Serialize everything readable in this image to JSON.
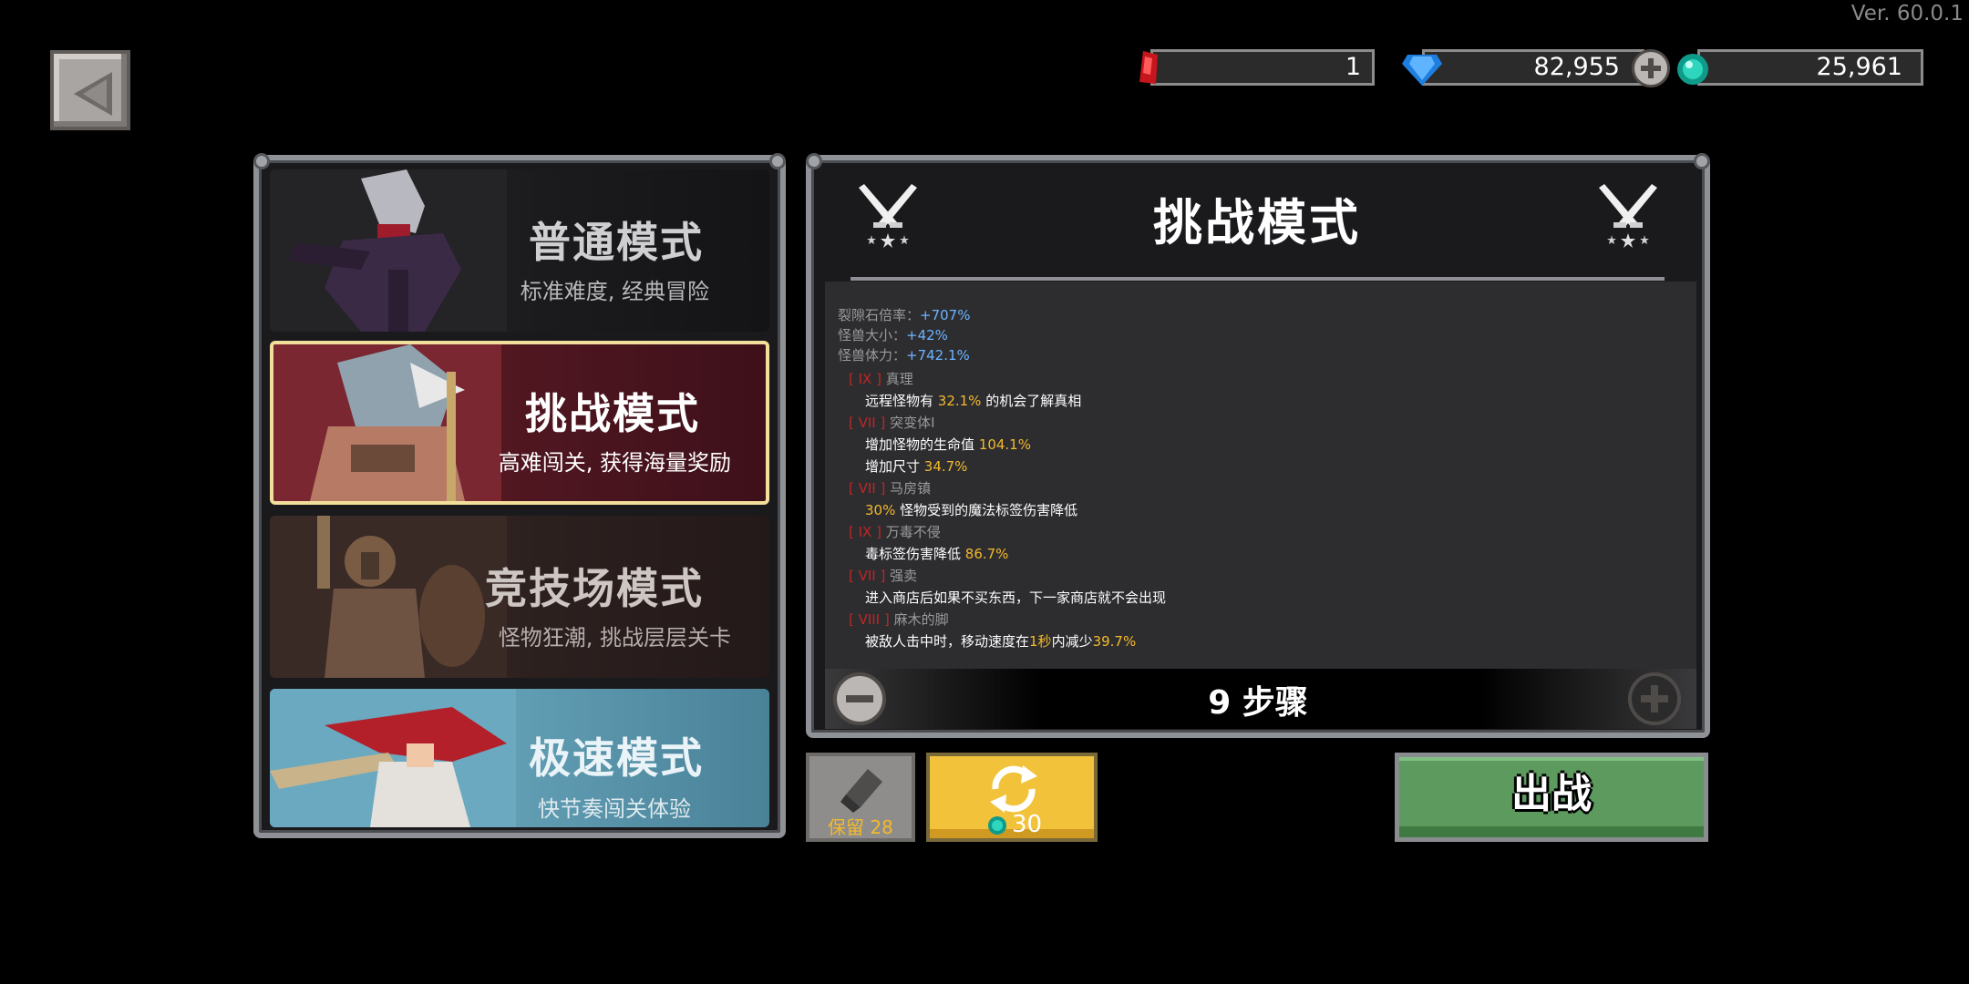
{
  "version": "Ver. 60.0.1",
  "currencies": {
    "rift_stone": "1",
    "gems": "82,955",
    "soul": "25,961"
  },
  "modes": [
    {
      "title": "普通模式",
      "desc": "标准难度, 经典冒险",
      "selected": false
    },
    {
      "title": "挑战模式",
      "desc": "高难闯关, 获得海量奖励",
      "selected": true
    },
    {
      "title": "竞技场模式",
      "desc": "怪物狂潮, 挑战层层关卡",
      "selected": false
    },
    {
      "title": "极速模式",
      "desc": "快节奏闯关体验",
      "selected": false
    }
  ],
  "detail": {
    "title": "挑战模式",
    "stats": [
      {
        "label": "裂隙石倍率：",
        "value": "+707%"
      },
      {
        "label": "怪兽大小：",
        "value": "+42%"
      },
      {
        "label": "怪兽体力：",
        "value": "+742.1%"
      }
    ],
    "modifiers": [
      {
        "tag": "[ IX ]",
        "name": "真理",
        "desc": [
          [
            "远程怪物有 ",
            ""
          ],
          [
            "32.1%",
            "hl"
          ],
          [
            " 的机会了解真相",
            ""
          ]
        ]
      },
      {
        "tag": "[ VII ]",
        "name": "突变体I",
        "desc": [
          [
            "增加怪物的生命值 ",
            ""
          ],
          [
            "104.1%",
            "hl"
          ]
        ],
        "desc2": [
          [
            "增加尺寸 ",
            ""
          ],
          [
            "34.7%",
            "hl"
          ]
        ]
      },
      {
        "tag": "[ VII ]",
        "name": "马房镇",
        "desc": [
          [
            "30%",
            "hl"
          ],
          [
            " 怪物受到的魔法标签伤害降低",
            ""
          ]
        ]
      },
      {
        "tag": "[ IX ]",
        "name": "万毒不侵",
        "desc": [
          [
            "毒标签伤害降低 ",
            ""
          ],
          [
            "86.7%",
            "hl"
          ]
        ]
      },
      {
        "tag": "[ VII ]",
        "name": "强卖",
        "desc": [
          [
            "进入商店后如果不买东西，下一家商店就不会出现",
            ""
          ]
        ]
      },
      {
        "tag": "[ VIII ]",
        "name": "麻木的脚",
        "desc": [
          [
            "被敌人击中时，移动速度在",
            ""
          ],
          [
            "1秒",
            "hl"
          ],
          [
            "内减少",
            ""
          ],
          [
            "39.7%",
            "hl"
          ]
        ]
      }
    ],
    "steps": "9 步骤"
  },
  "buttons": {
    "keep_label": "保留",
    "keep_count": "28",
    "reroll_cost": "30",
    "go_label": "出战"
  },
  "colors": {
    "accent_gold": "#f4b92c",
    "stat_blue": "#6cb4ff",
    "tag_red": "#c02626",
    "go_green": "#5c9a5e"
  }
}
